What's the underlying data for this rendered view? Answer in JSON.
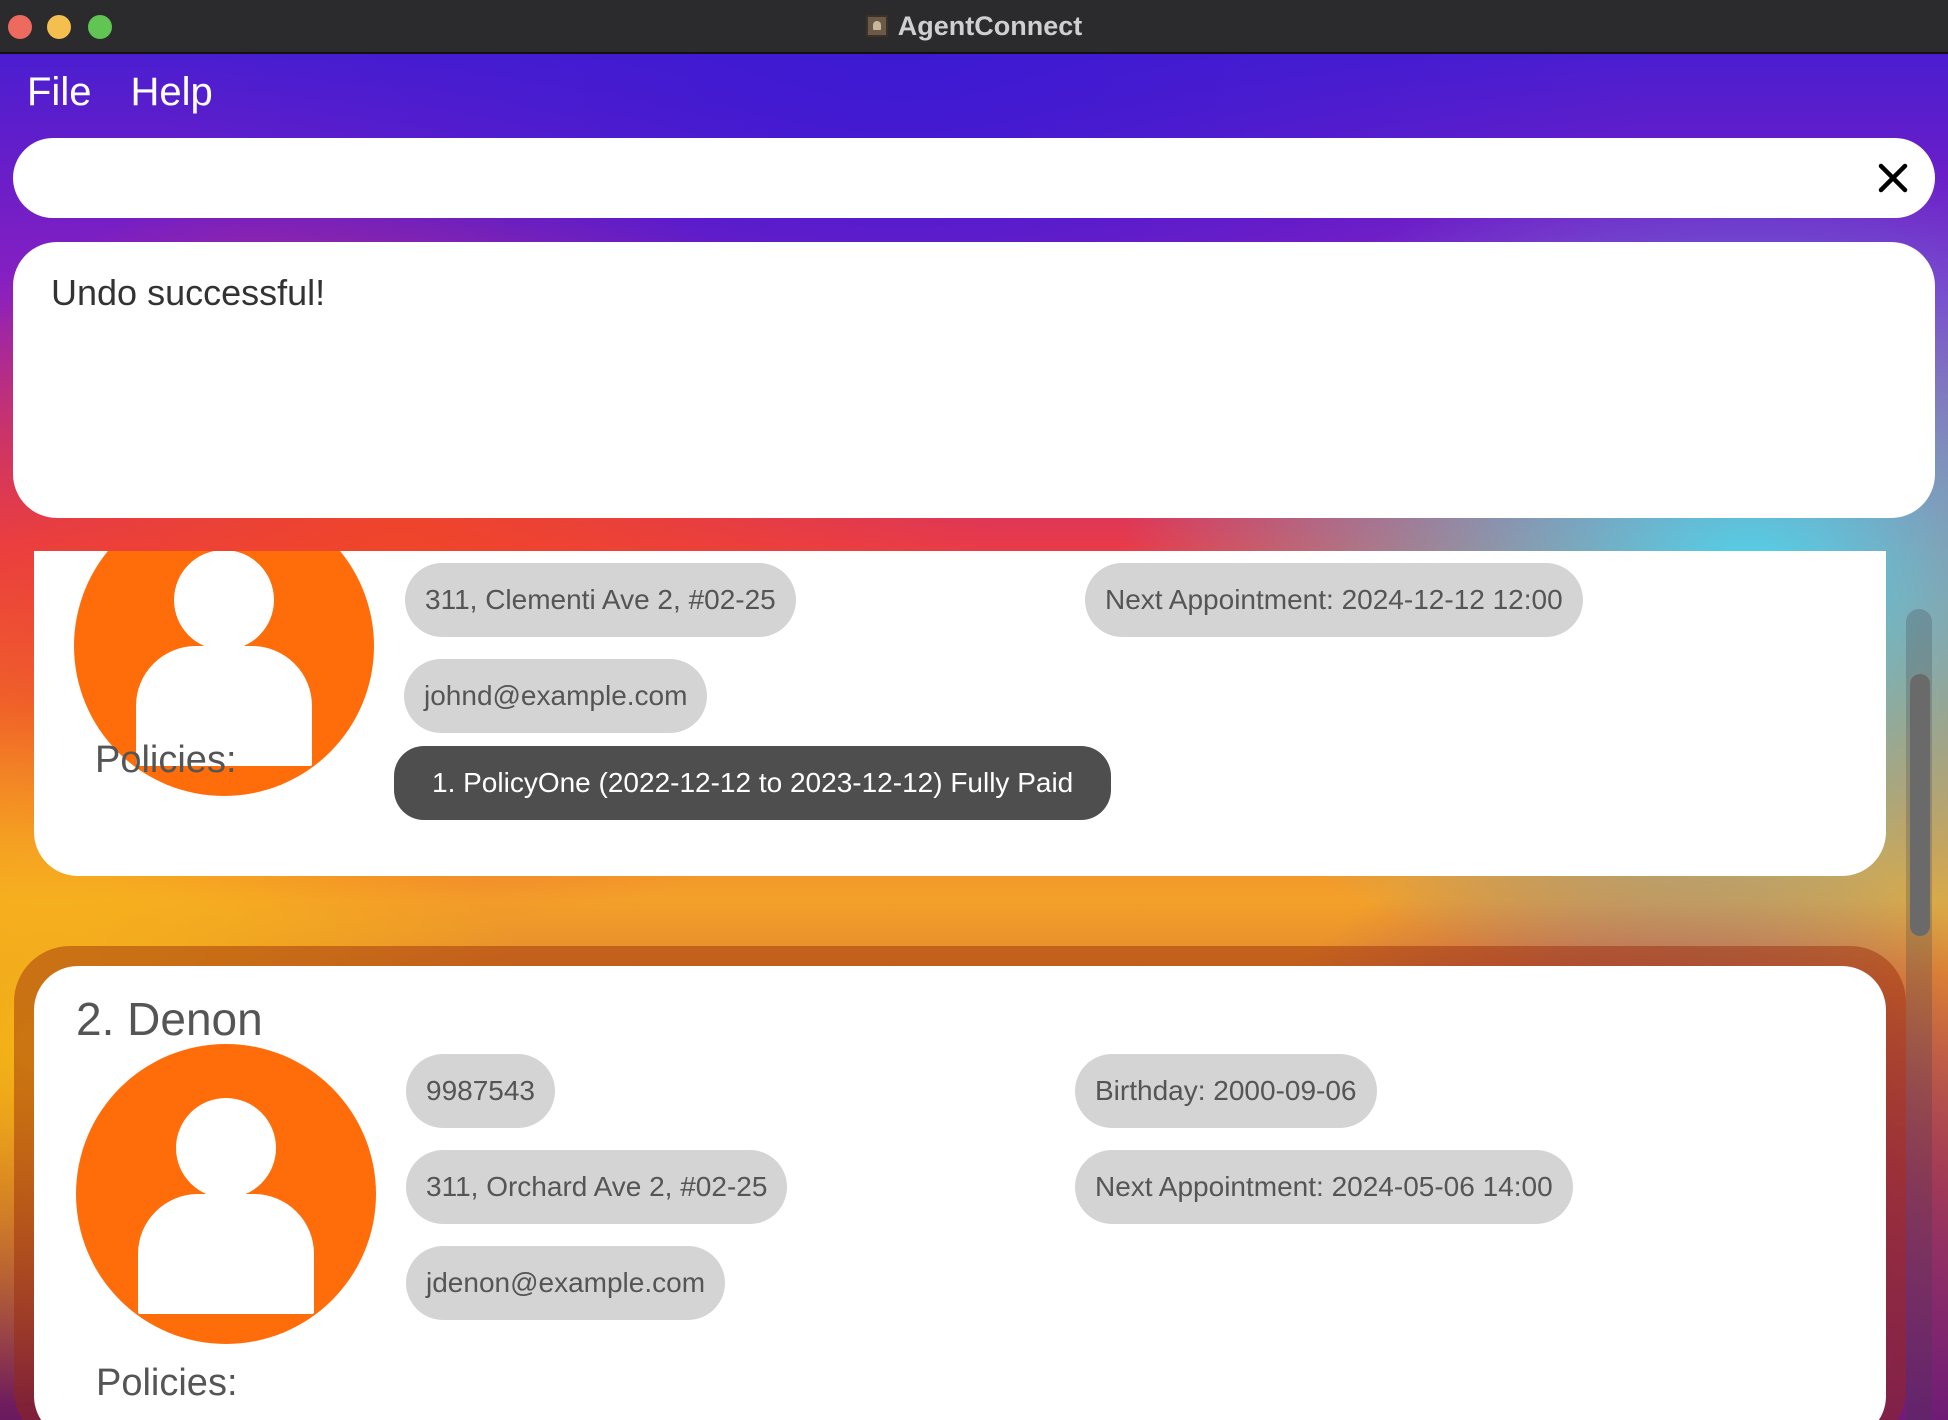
{
  "window": {
    "title": "AgentConnect"
  },
  "menu": {
    "file": "File",
    "help": "Help"
  },
  "command": {
    "value": "",
    "placeholder": ""
  },
  "result": {
    "message": "Undo successful!"
  },
  "persons": [
    {
      "name": "",
      "address": "311, Clementi Ave 2, #02-25",
      "email": "johnd@example.com",
      "next_appointment": "Next Appointment: 2024-12-12 12:00",
      "policies_label": "Policies:",
      "policies": [
        "1. PolicyOne (2022-12-12 to 2023-12-12) Fully Paid"
      ]
    },
    {
      "name": "2. Denon",
      "phone": "9987543",
      "address": "311, Orchard Ave 2, #02-25",
      "email": "jdenon@example.com",
      "birthday": "Birthday: 2000-09-06",
      "next_appointment": "Next Appointment: 2024-05-06 14:00",
      "policies_label": "Policies:",
      "policies": []
    }
  ],
  "colors": {
    "avatar": "#ff6d0a",
    "chip": "#d4d4d4",
    "policy_chip": "#4e4e4e"
  },
  "icons": {
    "clear": "close-icon",
    "avatar": "person-icon"
  }
}
